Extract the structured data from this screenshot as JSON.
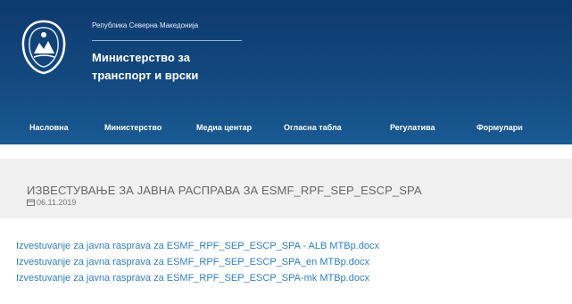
{
  "header": {
    "republic": "Република Северна Македонија",
    "ministry_line1": "Министерство за",
    "ministry_line2": "транспорт и врски",
    "crest_icon": "coat-of-arms-icon"
  },
  "nav": [
    {
      "label": "Насловна"
    },
    {
      "label": "Министерство"
    },
    {
      "label": "Медиа центар"
    },
    {
      "label": "Огласна табла"
    },
    {
      "label": "Регулатива"
    },
    {
      "label": "Формулари"
    }
  ],
  "article": {
    "title": "ИЗВЕСТУВАЊЕ ЗА ЈАВНА РАСПРАВА ЗА ESMF_RPF_SEP_ESCP_SPA",
    "date": "06.11.2019",
    "date_icon": "calendar-icon"
  },
  "attachments": [
    {
      "label": "Izvestuvanje za javna rasprava za ESMF_RPF_SEP_ESCP_SPA - ALB MTBp.docx"
    },
    {
      "label": "Izvestuvanje za javna rasprava za ESMF_RPF_SEP_ESCP_SPA_en MTBp.docx"
    },
    {
      "label": "Izvestuvanje za javna rasprava za ESMF_RPF_SEP_ESCP_SPA-mk MTBp.docx"
    }
  ],
  "colors": {
    "header": "#13497f",
    "link": "#2f7fc1",
    "content_bg": "#f0f0f0"
  }
}
